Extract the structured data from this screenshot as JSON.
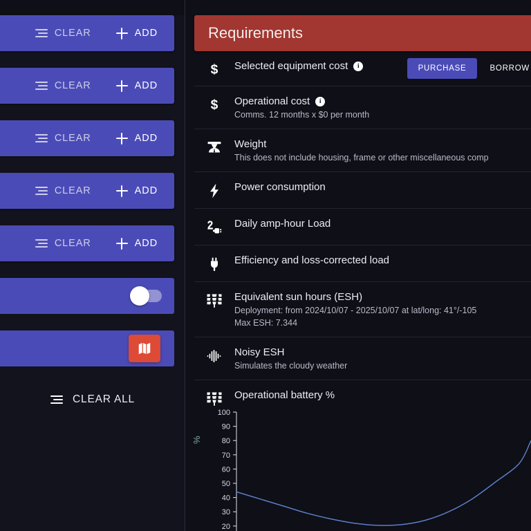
{
  "left_panel": {
    "action_rows": [
      {
        "clear_label": "CLEAR",
        "add_label": "ADD",
        "clear_icon": "clear-lines-icon",
        "add_icon": "plus-icon"
      },
      {
        "clear_label": "CLEAR",
        "add_label": "ADD",
        "clear_icon": "clear-lines-icon",
        "add_icon": "plus-icon"
      },
      {
        "clear_label": "CLEAR",
        "add_label": "ADD",
        "clear_icon": "clear-lines-icon",
        "add_icon": "plus-icon"
      },
      {
        "clear_label": "CLEAR",
        "add_label": "ADD",
        "clear_icon": "clear-lines-icon",
        "add_icon": "plus-icon"
      },
      {
        "clear_label": "CLEAR",
        "add_label": "ADD",
        "clear_icon": "clear-lines-icon",
        "add_icon": "plus-icon"
      }
    ],
    "toggle": {
      "name": "noisy-esh-toggle",
      "state": "off",
      "icon": "toggle-switch-icon"
    },
    "map_button": {
      "icon": "map-icon",
      "color": "#dd4a36"
    },
    "clear_all": {
      "label": "CLEAR ALL",
      "icon": "clear-lines-icon"
    },
    "accent_purple": "#4b4bb8",
    "panel_background": "#12131c"
  },
  "requirements": {
    "header": {
      "title": "Requirements",
      "color": "#a23630"
    },
    "rows": [
      {
        "icon": "dollar-sign-icon",
        "title": "Selected equipment cost",
        "has_info": true,
        "subtitle": "",
        "actions": [
          {
            "label": "PURCHASE",
            "style": "filled"
          },
          {
            "label": "BORROW",
            "style": "ghost"
          }
        ]
      },
      {
        "icon": "dollar-sign-icon",
        "title": "Operational cost",
        "has_info": true,
        "subtitle": "Comms. 12 months x $0 per month",
        "actions": []
      },
      {
        "icon": "weight-scale-icon",
        "title": "Weight",
        "has_info": false,
        "subtitle": "This does not include housing, frame or other miscellaneous comp",
        "actions": []
      },
      {
        "icon": "lightning-bolt-icon",
        "title": "Power consumption",
        "has_info": false,
        "subtitle": "",
        "actions": []
      },
      {
        "icon": "power-plug-cable-icon",
        "title": "Daily amp-hour Load",
        "has_info": false,
        "subtitle": "",
        "actions": []
      },
      {
        "icon": "plug-icon",
        "title": "Efficiency and loss-corrected load",
        "has_info": false,
        "subtitle": "",
        "actions": []
      },
      {
        "icon": "solar-panel-icon",
        "title": "Equivalent sun hours (ESH)",
        "has_info": false,
        "subtitle": "Deployment: from 2024/10/07 - 2025/10/07 at lat/long: 41°/-105",
        "subtitle2": "Max ESH: 7.344",
        "actions": []
      },
      {
        "icon": "waveform-icon",
        "title": "Noisy ESH",
        "has_info": false,
        "subtitle": "Simulates the cloudy weather",
        "actions": []
      },
      {
        "icon": "solar-panel-icon",
        "title": "Operational battery %",
        "has_info": false,
        "subtitle": "",
        "actions": []
      }
    ]
  },
  "chart_data": {
    "type": "line",
    "title": "Operational battery %",
    "xlabel": "",
    "ylabel": "%",
    "ylim": [
      20,
      100
    ],
    "yticks": [
      100,
      90,
      80,
      70,
      60,
      50,
      40,
      30,
      20
    ],
    "grid": false,
    "legend": null,
    "series": [
      {
        "name": "Operational battery %",
        "color": "#5b7fc7",
        "x": [
          0,
          0.08,
          0.16,
          0.24,
          0.32,
          0.4,
          0.48,
          0.56,
          0.64,
          0.72,
          0.8,
          0.88,
          0.96,
          1.0
        ],
        "values": [
          44,
          39,
          34,
          29,
          25,
          22,
          20.5,
          21,
          24,
          30,
          39,
          51,
          64,
          80
        ]
      }
    ]
  }
}
